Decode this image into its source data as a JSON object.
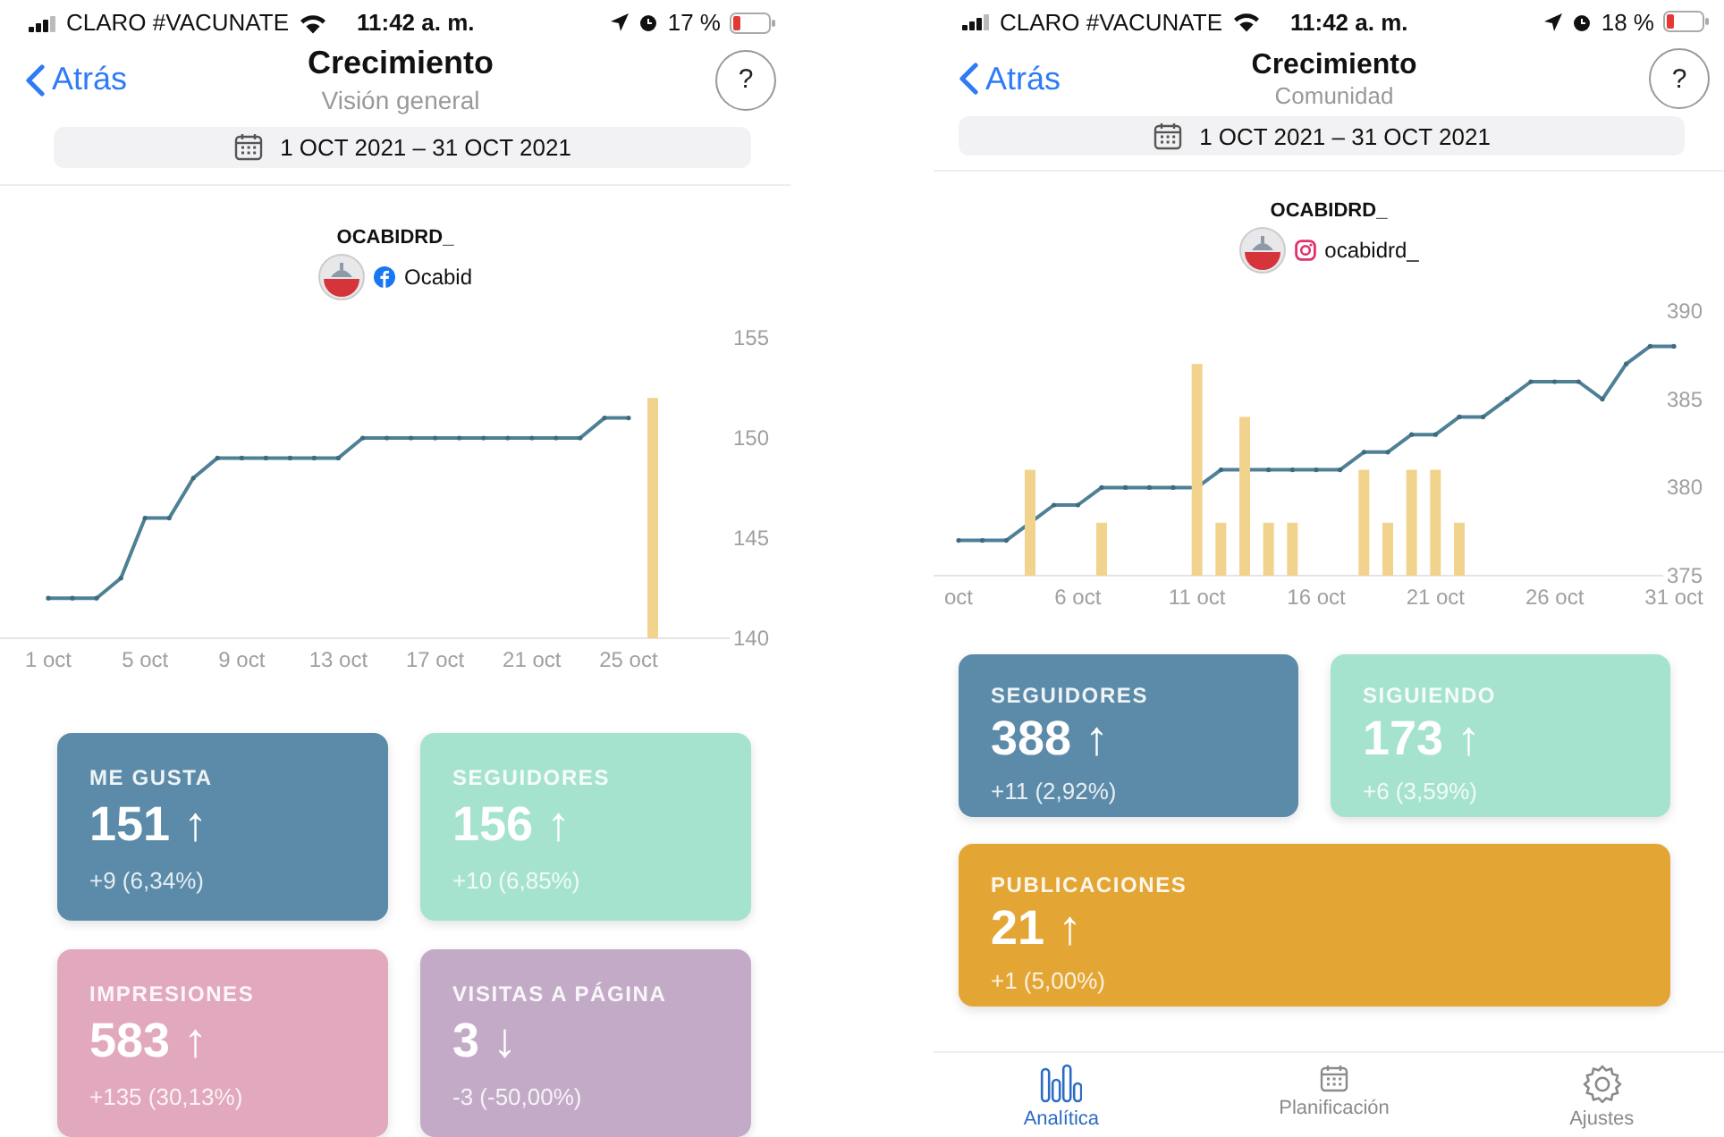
{
  "screens": [
    {
      "status_bar": {
        "carrier": "CLARO #VACUNATE",
        "time": "11:42 a. m.",
        "battery": "17 %"
      },
      "nav": {
        "back": "Atrás",
        "title": "Crecimiento",
        "subtitle": "Visión general",
        "help": "?"
      },
      "date_range": "1 OCT 2021 – 31 OCT 2021",
      "account": {
        "name": "OCABIDRD_",
        "handle": "Ocabid"
      },
      "chart_data": {
        "type": "line",
        "categories": [
          "1 oct",
          null,
          null,
          null,
          "5 oct",
          null,
          null,
          null,
          "9 oct",
          null,
          null,
          null,
          "13 oct",
          null,
          null,
          null,
          "17 oct",
          null,
          null,
          null,
          "21 oct",
          null,
          null,
          null,
          "25 oct",
          null
        ],
        "ylim": [
          140,
          155
        ],
        "yticks": [
          140,
          145,
          150,
          155
        ],
        "series": [
          {
            "type": "line",
            "color": "#4f8096",
            "values": [
              142,
              142,
              142,
              143,
              146,
              146,
              148,
              149,
              149,
              149,
              149,
              149,
              149,
              150,
              150,
              150,
              150,
              150,
              150,
              150,
              150,
              150,
              150,
              151,
              151,
              null
            ]
          },
          {
            "type": "bar",
            "color": "#f2d38e",
            "values": [
              null,
              null,
              null,
              null,
              null,
              null,
              null,
              null,
              null,
              null,
              null,
              null,
              null,
              null,
              null,
              null,
              null,
              null,
              null,
              null,
              null,
              null,
              null,
              null,
              null,
              152
            ]
          }
        ]
      },
      "card_rows": [
        [
          {
            "label": "ME GUSTA",
            "value": "151 ↑",
            "change": "+9 (6,34%)",
            "color": "#5b8ba8"
          },
          {
            "label": "SEGUIDORES",
            "value": "156 ↑",
            "change": "+10 (6,85%)",
            "color": "#a6e3cf"
          }
        ],
        [
          {
            "label": "IMPRESIONES",
            "value": "583 ↑",
            "change": "+135 (30,13%)",
            "color": "#e2a8bd"
          },
          {
            "label": "VISITAS A PÁGINA",
            "value": "3 ↓",
            "change": "-3 (-50,00%)",
            "color": "#c3abc8"
          }
        ]
      ]
    },
    {
      "status_bar": {
        "carrier": "CLARO #VACUNATE",
        "time": "11:42 a. m.",
        "battery": "18 %"
      },
      "nav": {
        "back": "Atrás",
        "title": "Crecimiento",
        "subtitle": "Comunidad",
        "help": "?"
      },
      "date_range": "1 OCT 2021 – 31 OCT 2021",
      "account": {
        "name": "OCABIDRD_",
        "handle": "ocabidrd_"
      },
      "chart_data": {
        "type": "line",
        "categories": [
          "oct",
          null,
          null,
          null,
          null,
          "6 oct",
          null,
          null,
          null,
          null,
          "11 oct",
          null,
          null,
          null,
          null,
          "16 oct",
          null,
          null,
          null,
          null,
          "21 oct",
          null,
          null,
          null,
          null,
          "26 oct",
          null,
          null,
          null,
          null,
          "31 oct"
        ],
        "ylim": [
          375,
          390
        ],
        "yticks": [
          375,
          380,
          385,
          390
        ],
        "series": [
          {
            "type": "line",
            "color": "#4f8096",
            "values": [
              377,
              377,
              377,
              378,
              379,
              379,
              380,
              380,
              380,
              380,
              380,
              381,
              381,
              381,
              381,
              381,
              381,
              382,
              382,
              383,
              383,
              384,
              384,
              385,
              386,
              386,
              386,
              385,
              387,
              388,
              388
            ]
          },
          {
            "type": "bar",
            "color": "#f2d38e",
            "values": [
              null,
              null,
              null,
              381,
              null,
              null,
              378,
              null,
              null,
              null,
              387,
              378,
              384,
              378,
              378,
              null,
              null,
              381,
              378,
              381,
              381,
              378,
              null,
              null,
              null,
              null,
              null,
              null,
              null,
              null,
              null
            ]
          }
        ]
      },
      "card_rows": [
        [
          {
            "label": "SEGUIDORES",
            "value": "388 ↑",
            "change": "+11 (2,92%)",
            "color": "#5b8ba8"
          },
          {
            "label": "SIGUIENDO",
            "value": "173 ↑",
            "change": "+6 (3,59%)",
            "color": "#a6e3cf"
          }
        ],
        [
          {
            "label": "PUBLICACIONES",
            "value": "21 ↑",
            "change": "+1 (5,00%)",
            "color": "#e3a634"
          }
        ]
      ],
      "tab_bar": [
        {
          "label": "Analítica",
          "kind": "analytics",
          "selected": true
        },
        {
          "label": "Planificación",
          "kind": "calendar",
          "selected": false
        },
        {
          "label": "Ajustes",
          "kind": "settings",
          "selected": false
        }
      ]
    }
  ]
}
